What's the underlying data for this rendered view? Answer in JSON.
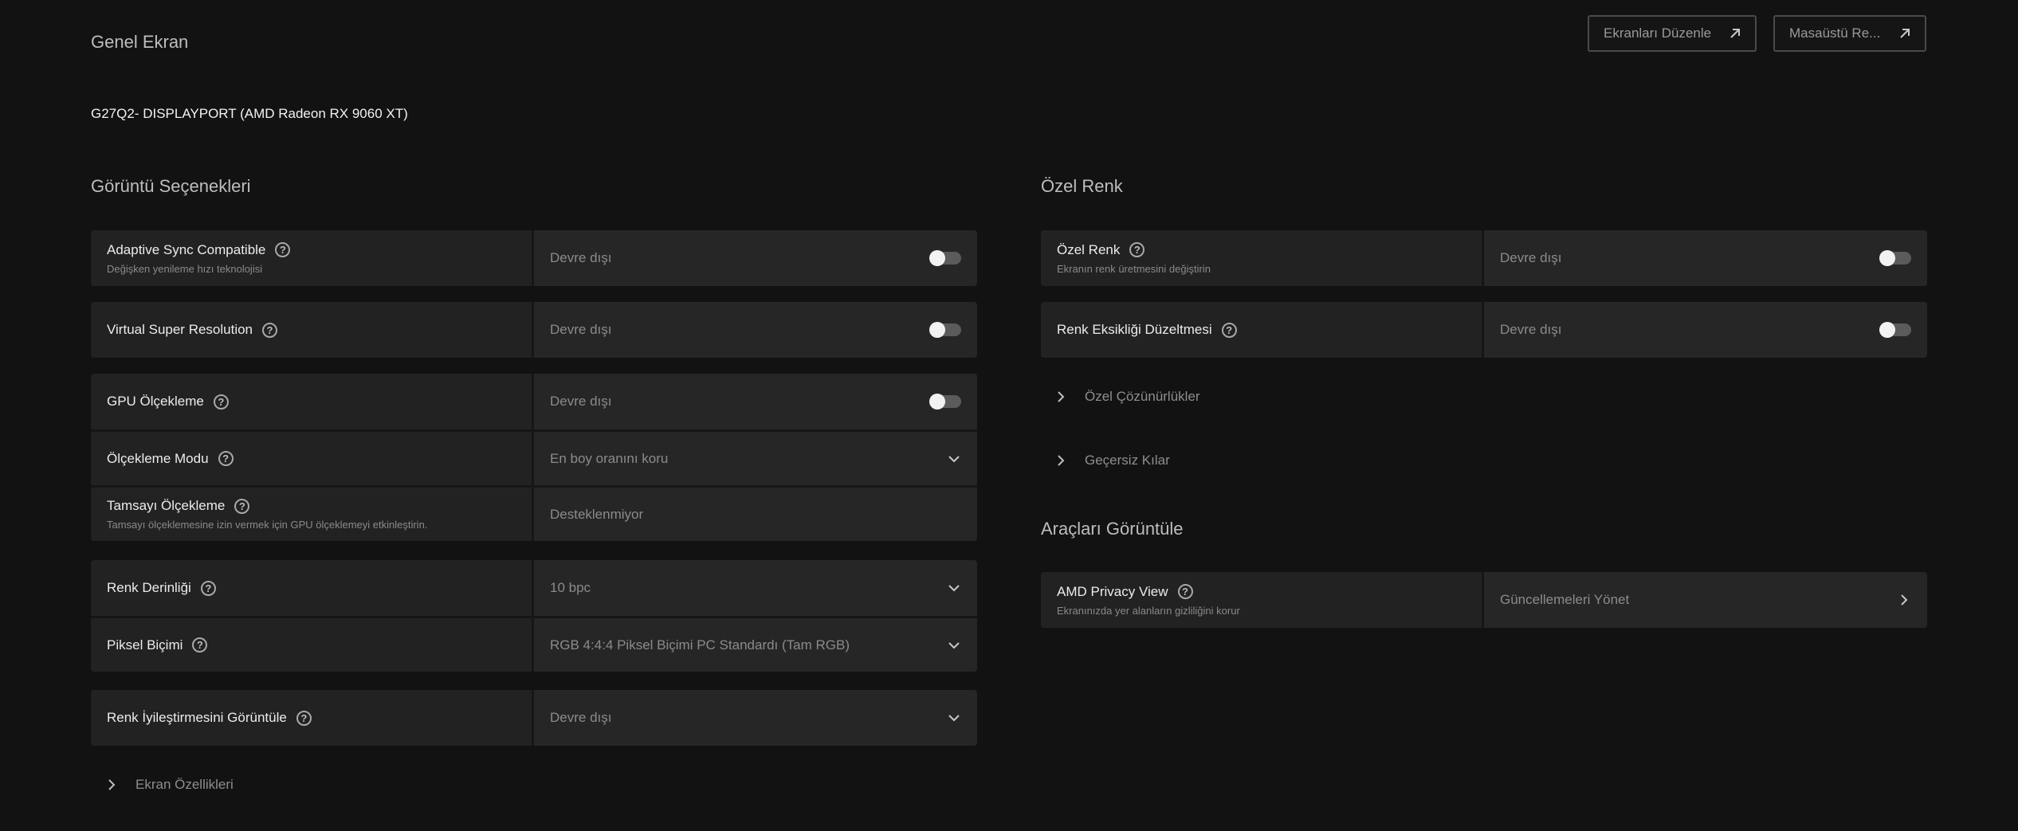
{
  "header": {
    "title": "Genel Ekran",
    "edit_displays_label": "Ekranları Düzenle",
    "desktop_label": "Masaüstü Re..."
  },
  "device": "G27Q2- DISPLAYPORT (AMD Radeon RX 9060 XT)",
  "display_options": {
    "title": "Görüntü Seçenekleri",
    "adaptive_sync": {
      "label": "Adaptive Sync Compatible",
      "sub": "Değişken yenileme hızı teknolojisi",
      "value": "Devre dışı"
    },
    "vsr": {
      "label": "Virtual Super Resolution",
      "value": "Devre dışı"
    },
    "gpu_scaling": {
      "label": "GPU Ölçekleme",
      "value": "Devre dışı"
    },
    "scaling_mode": {
      "label": "Ölçekleme Modu",
      "value": "En boy oranını koru"
    },
    "integer_scaling": {
      "label": "Tamsayı Ölçekleme",
      "sub": "Tamsayı ölçeklemesine izin vermek için GPU ölçeklemeyi etkinleştirin.",
      "value": "Desteklenmiyor"
    },
    "color_depth": {
      "label": "Renk Derinliği",
      "value": "10 bpc"
    },
    "pixel_format": {
      "label": "Piksel Biçimi",
      "value": "RGB 4:4:4 Piksel Biçimi PC Standardı (Tam RGB)"
    },
    "color_enhancement": {
      "label": "Renk İyileştirmesini Görüntüle",
      "value": "Devre dışı"
    },
    "display_specs": "Ekran Özellikleri"
  },
  "custom_color": {
    "title": "Özel Renk",
    "custom_color_row": {
      "label": "Özel Renk",
      "sub": "Ekranın renk üretmesini değiştirin",
      "value": "Devre dışı"
    },
    "color_deficiency": {
      "label": "Renk Eksikliği Düzeltmesi",
      "value": "Devre dışı"
    },
    "custom_resolutions": "Özel Çözünürlükler",
    "override": "Geçersiz Kılar"
  },
  "display_tools": {
    "title": "Araçları Görüntüle",
    "privacy_view": {
      "label": "AMD Privacy View",
      "sub": "Ekranınızda yer alanların gizliliğini korur",
      "value": "Güncellemeleri Yönet"
    }
  },
  "colors": {
    "background": "#121212",
    "row_left": "#222222",
    "row_right": "#262626"
  }
}
